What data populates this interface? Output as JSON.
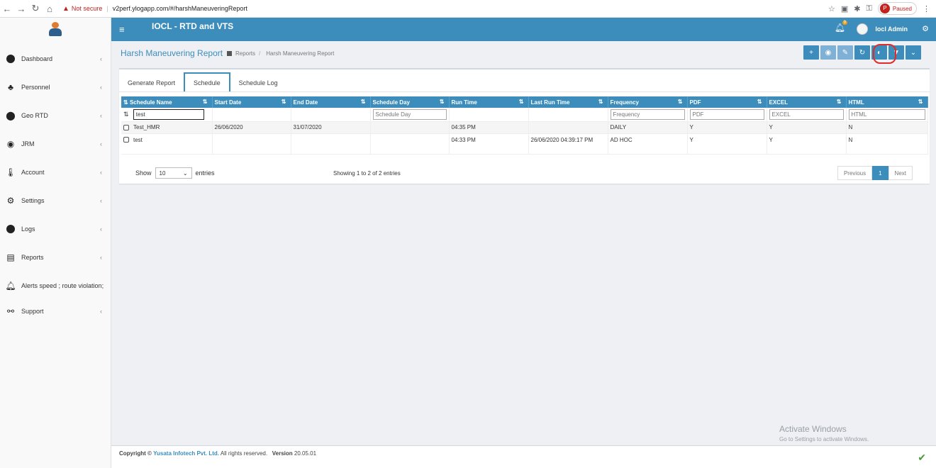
{
  "browser": {
    "not_secure": "Not secure",
    "url": "v2perf.ylogapp.com/#/harshManeuveringReport",
    "paused_label": "Paused",
    "paused_initial": "P"
  },
  "header": {
    "app_title": "IOCL - RTD and VTS",
    "notif_count": "9",
    "user_name": "Iocl Admin"
  },
  "sidebar": {
    "items": [
      {
        "label": "Dashboard",
        "icon": "dashboard-icon"
      },
      {
        "label": "Personnel",
        "icon": "users-icon"
      },
      {
        "label": "Geo RTD",
        "icon": "map-marker-icon"
      },
      {
        "label": "JRM",
        "icon": "life-ring-icon"
      },
      {
        "label": "Account",
        "icon": "thermometer-icon"
      },
      {
        "label": "Settings",
        "icon": "gear-icon"
      },
      {
        "label": "Logs",
        "icon": "clock-icon"
      },
      {
        "label": "Reports",
        "icon": "report-icon"
      },
      {
        "label": "Alerts speed ; route violation;",
        "icon": "bell-icon"
      },
      {
        "label": "Support",
        "icon": "support-icon"
      }
    ]
  },
  "page": {
    "title": "Harsh Maneuvering Report",
    "crumb_root": "Reports",
    "crumb_current": "Harsh Maneuvering Report"
  },
  "tabs": [
    "Generate Report",
    "Schedule",
    "Schedule Log"
  ],
  "table": {
    "columns": [
      "Schedule Name",
      "Start Date",
      "End Date",
      "Schedule Day",
      "Run Time",
      "Last Run Time",
      "Frequency",
      "PDF",
      "EXCEL",
      "HTML"
    ],
    "filters": {
      "schedule_name_value": "test",
      "schedule_day": "Schedule Day",
      "frequency": "Frequency",
      "pdf": "PDF",
      "excel": "EXCEL",
      "html": "HTML"
    },
    "rows": [
      [
        "Test_HMR",
        "26/06/2020",
        "31/07/2020",
        "",
        "04:35 PM",
        "",
        "DAILY",
        "Y",
        "Y",
        "N"
      ],
      [
        "test",
        "",
        "",
        "",
        "04:33 PM",
        "26/06/2020 04:39:17 PM",
        "AD HOC",
        "Y",
        "Y",
        "N"
      ]
    ]
  },
  "list_controls": {
    "show": "Show",
    "entries_value": "10",
    "entries": "entries",
    "info": "Showing 1 to 2 of 2 entries",
    "previous": "Previous",
    "page": "1",
    "next": "Next"
  },
  "footer": {
    "copyright": "Copyright ©",
    "company": "Yusata Infotech Pvt. Ltd.",
    "rights": "All rights reserved.",
    "version_label": "Version",
    "version": "20.05.01"
  },
  "watermark": {
    "line1": "Activate Windows",
    "line2": "Go to Settings to activate Windows."
  }
}
